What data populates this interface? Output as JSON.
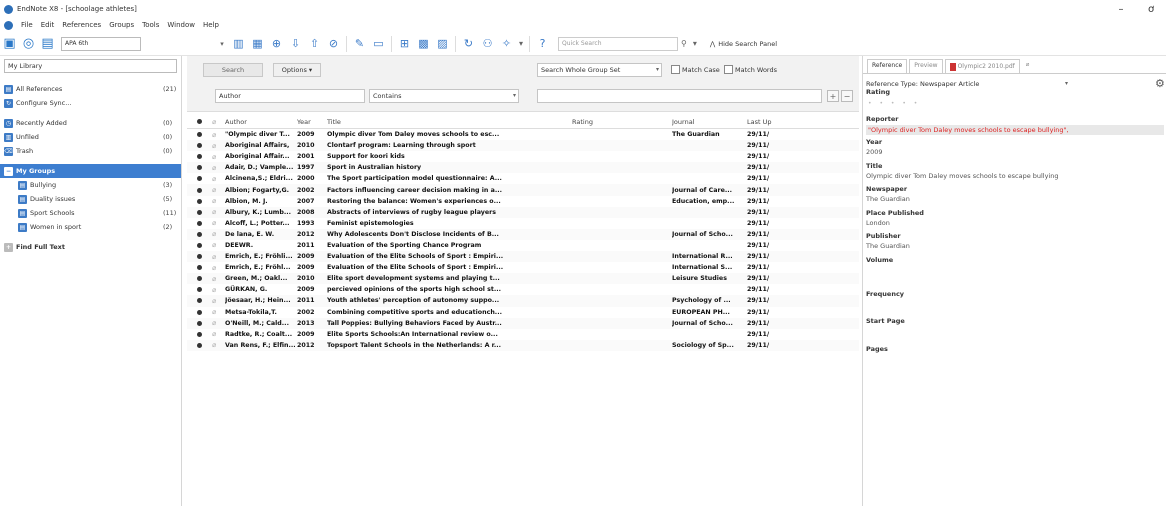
{
  "window": {
    "title": "EndNote X8 - [schoolage athletes]",
    "minimize": "–",
    "maximize": "ơ"
  },
  "menu": [
    "File",
    "Edit",
    "References",
    "Groups",
    "Tools",
    "Window",
    "Help"
  ],
  "toolbar": {
    "style_value": "APA 6th",
    "quick_search_placeholder": "Quick Search",
    "hide_search_panel": "Hide Search Panel"
  },
  "library": {
    "dropdown_value": "My Library",
    "groups": [
      {
        "label": "All References",
        "count": "(21)"
      },
      {
        "label": "Configure Sync...",
        "count": ""
      },
      {
        "label": "Recently Added",
        "count": "(0)"
      },
      {
        "label": "Unfiled",
        "count": "(0)"
      },
      {
        "label": "Trash",
        "count": "(0)"
      }
    ],
    "my_groups_label": "My Groups",
    "sub_groups": [
      {
        "label": "Bullying",
        "count": "(3)"
      },
      {
        "label": "Duality issues",
        "count": "(5)"
      },
      {
        "label": "Sport Schools",
        "count": "(11)"
      },
      {
        "label": "Women in sport",
        "count": "(2)"
      }
    ],
    "find_full_text": "Find Full Text"
  },
  "search": {
    "search_button": "Search",
    "options_button": "Options ▾",
    "scope_value": "Search Whole Group Set",
    "match_case": "Match Case",
    "match_words": "Match Words",
    "field_value": "Author",
    "operator_value": "Contains",
    "term_value": ""
  },
  "table": {
    "columns": {
      "author": "Author",
      "year": "Year",
      "title": "Title",
      "rating": "Rating",
      "journal": "Journal",
      "last_updated": "Last Up"
    },
    "rows": [
      {
        "author": "\"Olympic diver T...",
        "year": "2009",
        "title": "Olympic diver Tom Daley moves schools to esc...",
        "journal": "The Guardian",
        "updated": "29/11/"
      },
      {
        "author": "Aboriginal Affairs,",
        "year": "2010",
        "title": "Clontarf program: Learning through sport",
        "journal": "",
        "updated": "29/11/"
      },
      {
        "author": "Aboriginal Affair...",
        "year": "2001",
        "title": "Support for koori kids",
        "journal": "",
        "updated": "29/11/"
      },
      {
        "author": "Adair, D.; Vample...",
        "year": "1997",
        "title": "Sport in Australian history",
        "journal": "",
        "updated": "29/11/"
      },
      {
        "author": "Alcinena,S.; Eldri...",
        "year": "2000",
        "title": "The Sport participation model questionnaire: A...",
        "journal": "",
        "updated": "29/11/"
      },
      {
        "author": "Albion; Fogarty,G.",
        "year": "2002",
        "title": "Factors influencing career decision making in a...",
        "journal": "Journal of Care...",
        "updated": "29/11/"
      },
      {
        "author": "Albion, M. J.",
        "year": "2007",
        "title": "Restoring the balance: Women's experiences o...",
        "journal": "Education, emp...",
        "updated": "29/11/"
      },
      {
        "author": "Albury, K.; Lumb...",
        "year": "2008",
        "title": "Abstracts of interviews of rugby league players",
        "journal": "",
        "updated": "29/11/"
      },
      {
        "author": "Alcoff, L.; Potter...",
        "year": "1993",
        "title": "Feminist epistemologies",
        "journal": "",
        "updated": "29/11/"
      },
      {
        "author": "De lana, E. W.",
        "year": "2012",
        "title": "Why Adolescents Don't Disclose Incidents of B...",
        "journal": "Journal of Scho...",
        "updated": "29/11/"
      },
      {
        "author": "DEEWR.",
        "year": "2011",
        "title": "Evaluation of the Sporting Chance Program",
        "journal": "",
        "updated": "29/11/"
      },
      {
        "author": "Emrich, E.; Fröhli...",
        "year": "2009",
        "title": "Evaluation of the Elite Schools of Sport : Empiri...",
        "journal": "International R...",
        "updated": "29/11/"
      },
      {
        "author": "Emrich, E.; Fröhl...",
        "year": "2009",
        "title": "Evaluation of the Elite Schools of Sport : Empiri...",
        "journal": "International S...",
        "updated": "29/11/"
      },
      {
        "author": "Green, M.; Oakl...",
        "year": "2010",
        "title": "Elite sport development systems and playing t...",
        "journal": "Leisure Studies",
        "updated": "29/11/"
      },
      {
        "author": "GÜRKAN, G.",
        "year": "2009",
        "title": "percieved opinions of the sports high school st...",
        "journal": "",
        "updated": "29/11/"
      },
      {
        "author": "Jöesaar, H.; Hein...",
        "year": "2011",
        "title": "Youth athletes' perception of autonomy suppo...",
        "journal": "Psychology of ...",
        "updated": "29/11/"
      },
      {
        "author": "Metsa-Tokila,T.",
        "year": "2002",
        "title": "Combining competitive sports and educationch...",
        "journal": "EUROPEAN PH...",
        "updated": "29/11/"
      },
      {
        "author": "O'Neill, M.; Cald...",
        "year": "2013",
        "title": "Tall Poppies: Bullying Behaviors Faced by Austr...",
        "journal": "Journal of Scho...",
        "updated": "29/11/"
      },
      {
        "author": "Radtke, R.; Coalt...",
        "year": "2009",
        "title": "Elite Sports Schools:An International review o...",
        "journal": "",
        "updated": "29/11/"
      },
      {
        "author": "Van Rens, F.; Elfin...",
        "year": "2012",
        "title": "Topsport Talent Schools in the Netherlands: A r...",
        "journal": "Sociology of Sp...",
        "updated": "29/11/"
      }
    ]
  },
  "preview": {
    "tabs": [
      "Reference",
      "Preview",
      "Olympic2 2010.pdf"
    ],
    "ref_type": "Reference Type: Newspaper Article",
    "fields": {
      "rating_label": "Rating",
      "rating_value": 0,
      "reporter_label": "Reporter",
      "reporter_value": "\"Olympic diver Tom Daley moves schools to escape bullying\",",
      "year_label": "Year",
      "year_value": "2009",
      "title_label": "Title",
      "title_value": "Olympic diver Tom Daley moves schools to escape bullying",
      "newspaper_label": "Newspaper",
      "newspaper_value": "The Guardian",
      "place_label": "Place Published",
      "place_value": "London",
      "publisher_label": "Publisher",
      "publisher_value": "The Guardian",
      "volume_label": "Volume",
      "frequency_label": "Frequency",
      "startpage_label": "Start Page",
      "pages_label": "Pages"
    }
  }
}
